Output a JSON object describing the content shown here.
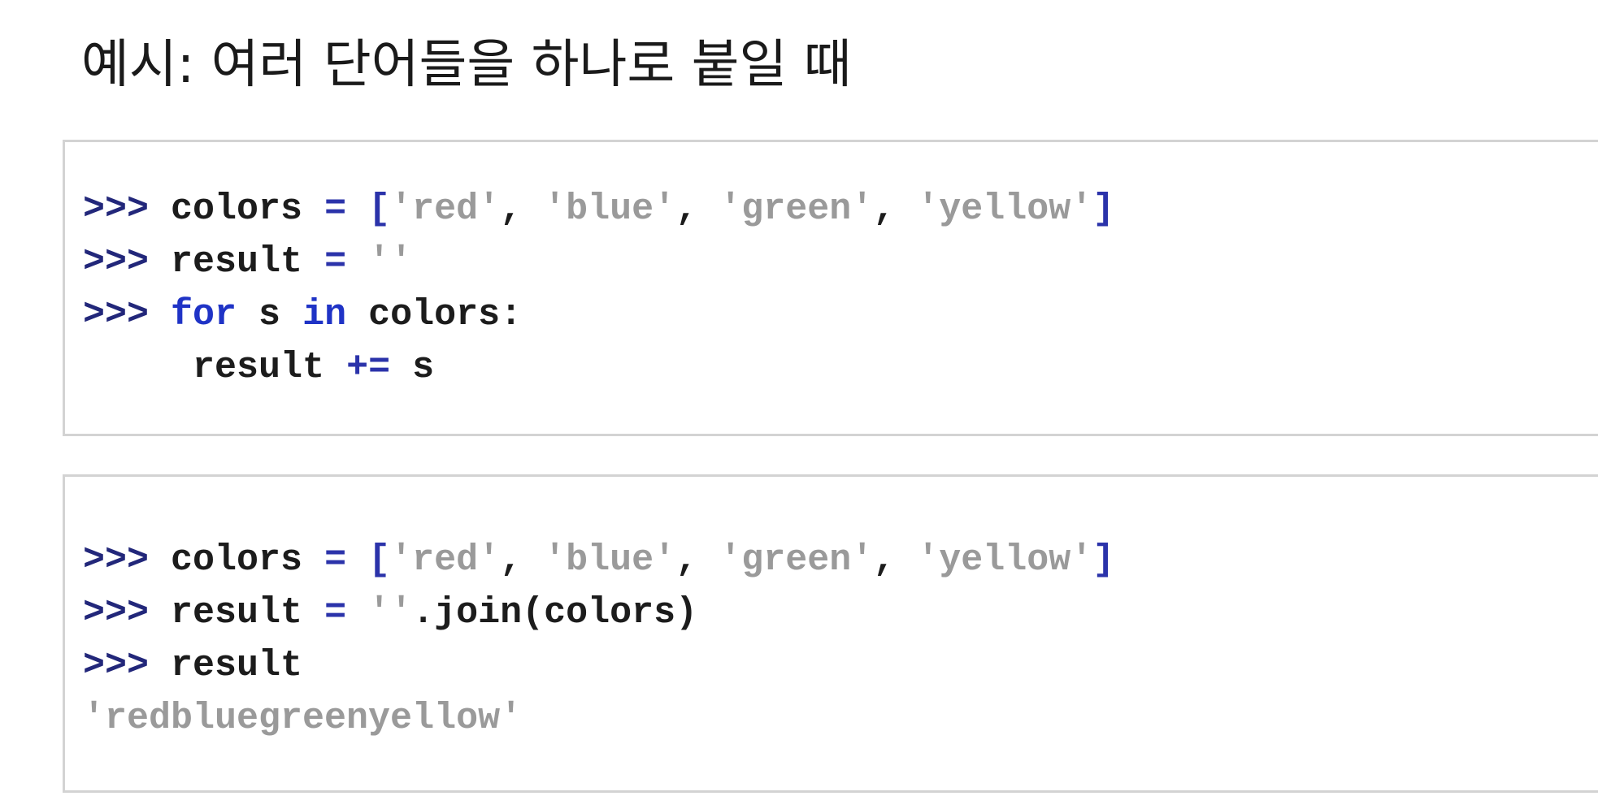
{
  "title": "예시: 여러 단어들을 하나로 붙일 때",
  "example1": {
    "lines": [
      {
        "prompt": ">>>",
        "t1": " colors ",
        "op1": "=",
        "t2": " ",
        "lbr": "[",
        "s1": "'red'",
        "c1": ", ",
        "s2": "'blue'",
        "c2": ", ",
        "s3": "'green'",
        "c3": ", ",
        "s4": "'yellow'",
        "rbr": "]"
      },
      {
        "prompt": ">>>",
        "t1": " result ",
        "op1": "=",
        "t2": " ",
        "s1": "''"
      },
      {
        "prompt": ">>>",
        "t1": " ",
        "kw1": "for",
        "t2": " s ",
        "kw2": "in",
        "t3": " colors:"
      },
      {
        "indent": "     ",
        "t1": "result ",
        "op1": "+=",
        "t2": " s"
      }
    ]
  },
  "example2": {
    "lines": [
      {
        "prompt": ">>>",
        "t1": " colors ",
        "op1": "=",
        "t2": " ",
        "lbr": "[",
        "s1": "'red'",
        "c1": ", ",
        "s2": "'blue'",
        "c2": ", ",
        "s3": "'green'",
        "c3": ", ",
        "s4": "'yellow'",
        "rbr": "]"
      },
      {
        "prompt": ">>>",
        "t1": " result ",
        "op1": "=",
        "t2": " ",
        "s1": "''",
        "t3": ".join(colors)"
      },
      {
        "prompt": ">>>",
        "t1": " result"
      },
      {
        "output": "'redbluegreenyellow'"
      }
    ]
  }
}
